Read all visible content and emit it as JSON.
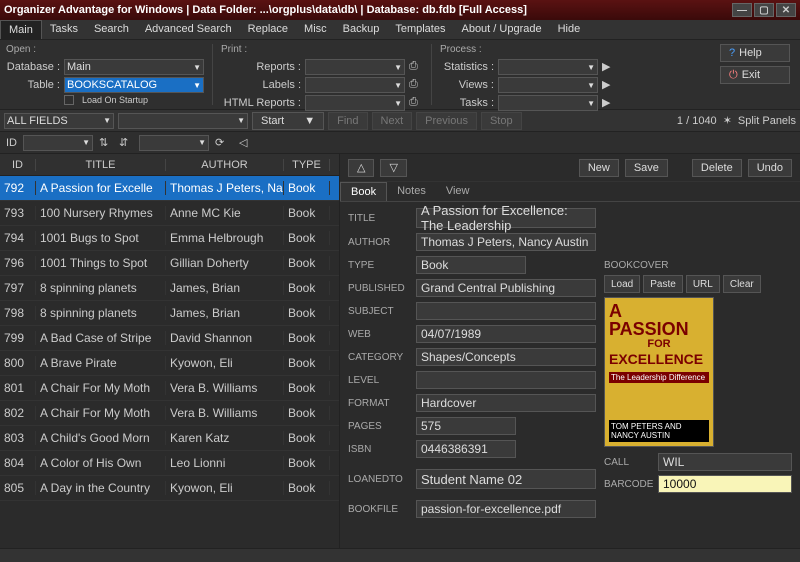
{
  "window": {
    "title": "Organizer Advantage for Windows | Data Folder: ...\\orgplus\\data\\db\\ | Database: db.fdb [Full Access]"
  },
  "menu": [
    "Main",
    "Tasks",
    "Search",
    "Advanced Search",
    "Replace",
    "Misc",
    "Backup",
    "Templates",
    "About / Upgrade",
    "Hide"
  ],
  "menu_active": 0,
  "ribbon": {
    "open": {
      "title": "Open :",
      "database_lbl": "Database :",
      "database_val": "Main",
      "table_lbl": "Table :",
      "table_val": "BOOKSCATALOG",
      "startup": "Load On Startup"
    },
    "print": {
      "title": "Print :",
      "reports": "Reports :",
      "labels": "Labels :",
      "html": "HTML Reports :"
    },
    "process": {
      "title": "Process :",
      "stats": "Statistics :",
      "views": "Views :",
      "tasks": "Tasks :"
    },
    "help": "Help",
    "exit": "Exit"
  },
  "searchbar": {
    "field": "ALL FIELDS",
    "start": "Start",
    "find": "Find",
    "next": "Next",
    "prev": "Previous",
    "stop": "Stop",
    "count": "1 / 1040",
    "split": "Split Panels"
  },
  "toolbar2": {
    "id_lbl": "ID"
  },
  "table": {
    "headers": {
      "id": "ID",
      "title": "TITLE",
      "author": "AUTHOR",
      "type": "TYPE"
    },
    "rows": [
      {
        "id": "792",
        "title": "A Passion for Excelle",
        "author": "Thomas J Peters, Na",
        "type": "Book",
        "sel": true
      },
      {
        "id": "793",
        "title": "100 Nursery Rhymes",
        "author": "Anne MC Kie",
        "type": "Book"
      },
      {
        "id": "794",
        "title": "1001 Bugs to Spot",
        "author": "Emma Helbrough",
        "type": "Book"
      },
      {
        "id": "796",
        "title": "1001 Things to Spot",
        "author": "Gillian Doherty",
        "type": "Book"
      },
      {
        "id": "797",
        "title": "8 spinning planets",
        "author": "James, Brian",
        "type": "Book"
      },
      {
        "id": "798",
        "title": "8 spinning planets",
        "author": "James, Brian",
        "type": "Book"
      },
      {
        "id": "799",
        "title": "A Bad Case of Stripe",
        "author": "David Shannon",
        "type": "Book"
      },
      {
        "id": "800",
        "title": "A Brave Pirate",
        "author": "Kyowon, Eli",
        "type": "Book"
      },
      {
        "id": "801",
        "title": "A Chair For My Moth",
        "author": "Vera B. Williams",
        "type": "Book"
      },
      {
        "id": "802",
        "title": "A Chair For My Moth",
        "author": "Vera B. Williams",
        "type": "Book"
      },
      {
        "id": "803",
        "title": "A Child's Good Morn",
        "author": "Karen Katz",
        "type": "Book"
      },
      {
        "id": "804",
        "title": "A Color of His Own",
        "author": "Leo Lionni",
        "type": "Book"
      },
      {
        "id": "805",
        "title": "A Day in the Country",
        "author": "Kyowon, Eli",
        "type": "Book"
      }
    ]
  },
  "actions": {
    "new": "New",
    "save": "Save",
    "delete": "Delete",
    "undo": "Undo"
  },
  "detail_tabs": [
    "Book",
    "Notes",
    "View"
  ],
  "detail_tab_active": 0,
  "form": {
    "title_lbl": "TITLE",
    "title": "A Passion for Excellence: The Leadership",
    "author_lbl": "AUTHOR",
    "author": "Thomas J Peters, Nancy Austin",
    "type_lbl": "TYPE",
    "type": "Book",
    "published_lbl": "PUBLISHED",
    "published": "Grand Central Publishing",
    "subject_lbl": "SUBJECT",
    "subject": "",
    "web_lbl": "WEB",
    "web": "04/07/1989",
    "category_lbl": "CATEGORY",
    "category": "Shapes/Concepts",
    "level_lbl": "LEVEL",
    "level": "",
    "format_lbl": "FORMAT",
    "format": "Hardcover",
    "pages_lbl": "PAGES",
    "pages": "575",
    "isbn_lbl": "ISBN",
    "isbn": "0446386391",
    "loaned_lbl": "LOANEDTO",
    "loaned": "Student Name 02",
    "bookfile_lbl": "BOOKFILE",
    "bookfile": "passion-for-excellence.pdf",
    "cover_lbl": "BOOKCOVER",
    "load": "Load",
    "paste": "Paste",
    "url": "URL",
    "clear": "Clear",
    "call_lbl": "CALL",
    "call": "WIL",
    "barcode_lbl": "BARCODE",
    "barcode": "10000",
    "cover_text1": "A",
    "cover_text2": "PASSION",
    "cover_for": "FOR",
    "cover_text3": "EXCELLENCE",
    "cover_sub": "The Leadership Difference",
    "cover_auth": "TOM PETERS AND NANCY AUSTIN"
  }
}
